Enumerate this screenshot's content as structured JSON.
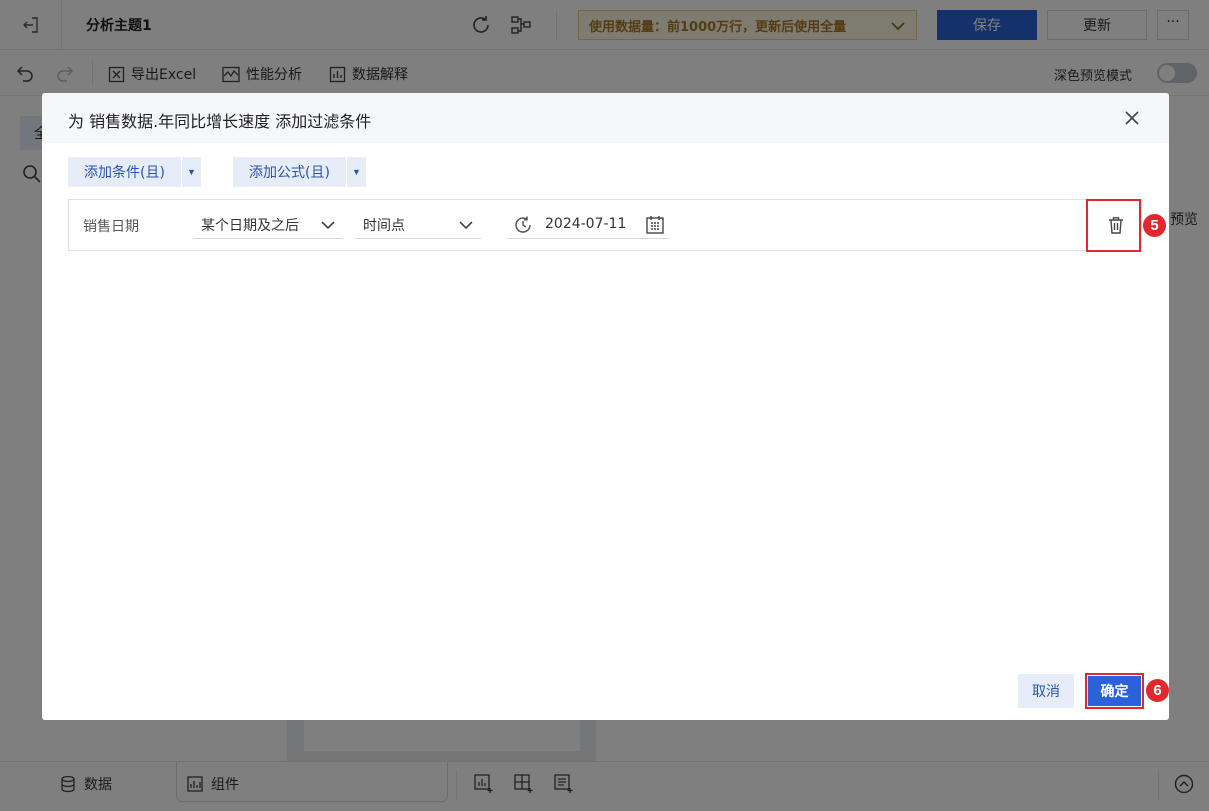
{
  "app": {
    "title": "分析主题1",
    "data_notice": "使用数据量：前1000万行，更新后使用全量",
    "save_label": "保存",
    "update_label": "更新",
    "more_label": "···"
  },
  "toolbar": {
    "export_label": "导出Excel",
    "perf_label": "性能分析",
    "explain_label": "数据解释",
    "dark_mode_label": "深色预览模式",
    "dark_mode_on": false
  },
  "background_peek": {
    "left_tab": "全",
    "right_label": "预览"
  },
  "bottombar": {
    "data_tab": "数据",
    "widgets_tab": "组件"
  },
  "dialog": {
    "title": "为 销售数据.年同比增长速度 添加过滤条件",
    "add_condition_label": "添加条件(且)",
    "add_formula_label": "添加公式(且)",
    "condition": {
      "field": "销售日期",
      "operator": "某个日期及之后",
      "type": "时间点",
      "date_value": "2024-07-11"
    },
    "cancel_label": "取消",
    "ok_label": "确定"
  },
  "annotations": {
    "delete_step": "5",
    "confirm_step": "6",
    "highlight_color": "#e0282e"
  },
  "colors": {
    "primary": "#2b62d9",
    "light_button_bg": "#e6edf9",
    "notice_bg": "#fdf6e3",
    "notice_text": "#a8782a"
  }
}
